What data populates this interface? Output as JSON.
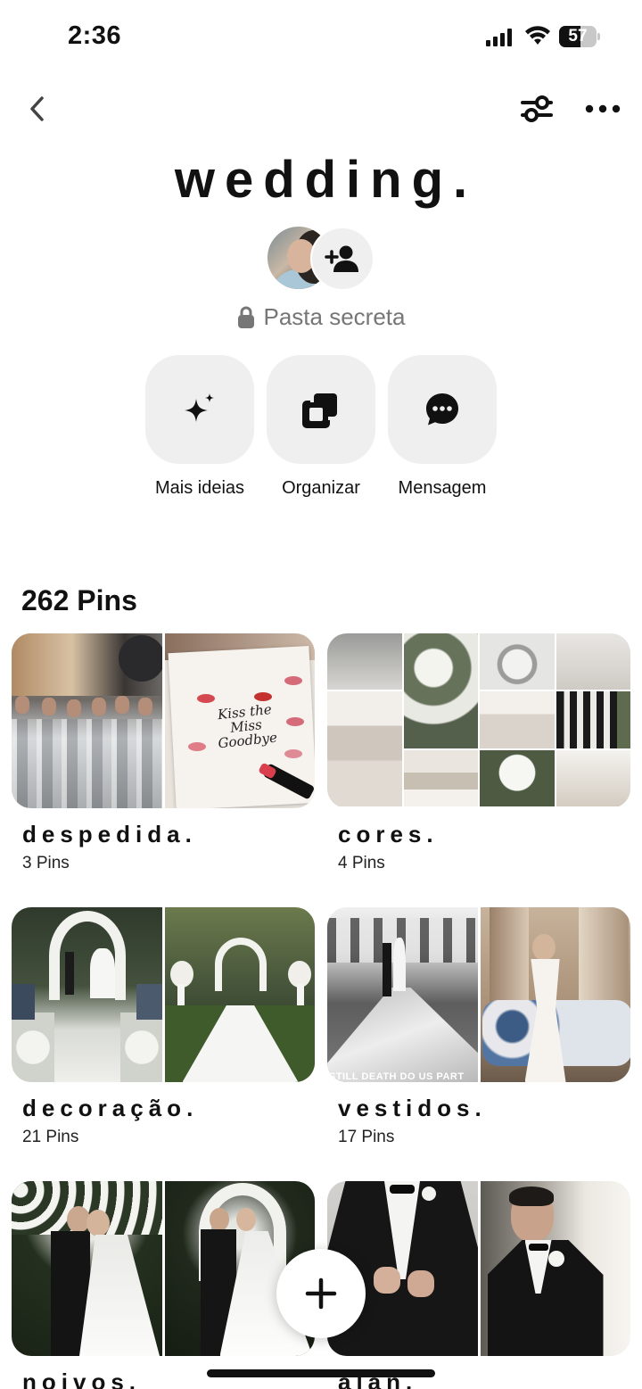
{
  "status_bar": {
    "time": "2:36",
    "battery": "57",
    "battery_level": 0.57
  },
  "nav": {
    "back_icon": "chevron-left-icon",
    "filter_icon": "sliders-icon",
    "more_icon": "ellipsis-icon"
  },
  "board": {
    "title": "wedding.",
    "secret_label": "Pasta secreta",
    "pins_count": "262 Pins"
  },
  "actions": [
    {
      "label": "Mais ideias",
      "icon": "sparkle-icon"
    },
    {
      "label": "Organizar",
      "icon": "organize-icon"
    },
    {
      "label": "Mensagem",
      "icon": "message-icon"
    }
  ],
  "sections": [
    {
      "name": "despedida.",
      "count": "3 Pins"
    },
    {
      "name": "cores.",
      "count": "4 Pins"
    },
    {
      "name": "decoração.",
      "count": "21 Pins"
    },
    {
      "name": "vestidos.",
      "count": "17 Pins"
    },
    {
      "name": "noivos.",
      "count": ""
    },
    {
      "name": "alan.",
      "count": ""
    }
  ],
  "cover_texts": {
    "invite": "Kiss the Miss Goodbye",
    "veil_caption": "STILL DEATH DO US PART"
  },
  "colors": {
    "text": "#111111",
    "muted": "#767676",
    "chip": "#efefef"
  }
}
